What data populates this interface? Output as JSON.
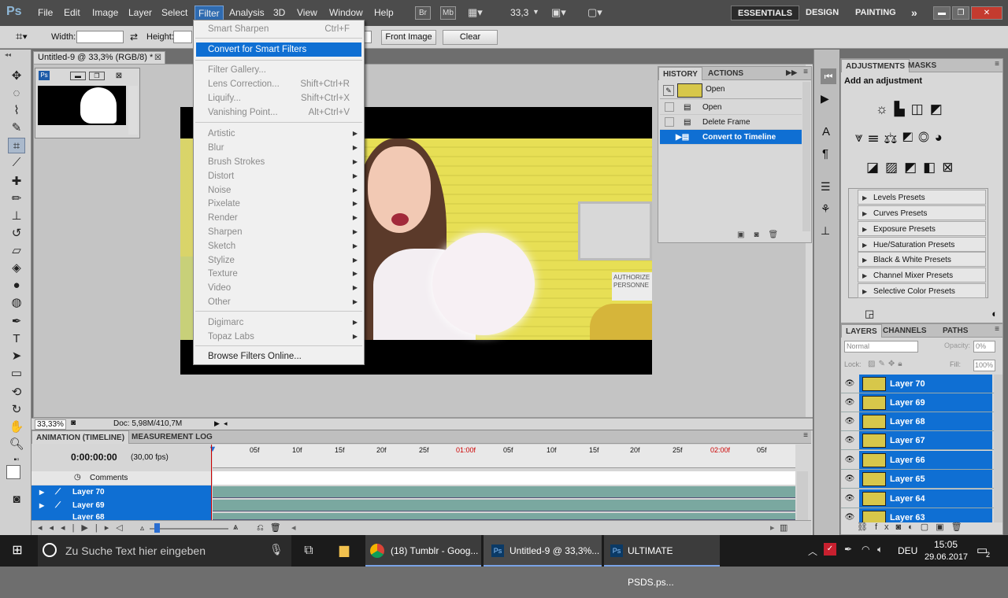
{
  "menubar": {
    "logo": "Ps",
    "items": [
      "File",
      "Edit",
      "Image",
      "Layer",
      "Select",
      "Filter",
      "Analysis",
      "3D",
      "View",
      "Window",
      "Help"
    ],
    "bridge_btn": "Br",
    "mini_btn": "Mb",
    "zoom_value": "33,3",
    "workspaces": [
      "ESSENTIALS",
      "DESIGN",
      "PAINTING"
    ],
    "more": "»"
  },
  "options": {
    "width_label": "Width:",
    "height_label": "Height:",
    "front_image": "Front Image",
    "clear": "Clear"
  },
  "document": {
    "tab_title": "Untitled-9 @ 33,3% (RGB/8) *",
    "zoom": "33,33%",
    "doc_size": "Doc: 5,98M/410,7M",
    "sign_text": "AUTHORIZE\nPERSONNE"
  },
  "filter_menu": {
    "items": [
      {
        "label": "Smart Sharpen",
        "shortcut": "Ctrl+F",
        "enabled": false
      },
      {
        "label": "Convert for Smart Filters",
        "shortcut": "",
        "enabled": true,
        "highlight": true
      },
      {
        "label": "Filter Gallery...",
        "shortcut": "",
        "enabled": false
      },
      {
        "label": "Lens Correction...",
        "shortcut": "Shift+Ctrl+R",
        "enabled": false
      },
      {
        "label": "Liquify...",
        "shortcut": "Shift+Ctrl+X",
        "enabled": false
      },
      {
        "label": "Vanishing Point...",
        "shortcut": "Alt+Ctrl+V",
        "enabled": false
      },
      {
        "label": "Artistic",
        "submenu": true,
        "enabled": false
      },
      {
        "label": "Blur",
        "submenu": true,
        "enabled": false
      },
      {
        "label": "Brush Strokes",
        "submenu": true,
        "enabled": false
      },
      {
        "label": "Distort",
        "submenu": true,
        "enabled": false
      },
      {
        "label": "Noise",
        "submenu": true,
        "enabled": false
      },
      {
        "label": "Pixelate",
        "submenu": true,
        "enabled": false
      },
      {
        "label": "Render",
        "submenu": true,
        "enabled": false
      },
      {
        "label": "Sharpen",
        "submenu": true,
        "enabled": false
      },
      {
        "label": "Sketch",
        "submenu": true,
        "enabled": false
      },
      {
        "label": "Stylize",
        "submenu": true,
        "enabled": false
      },
      {
        "label": "Texture",
        "submenu": true,
        "enabled": false
      },
      {
        "label": "Video",
        "submenu": true,
        "enabled": false
      },
      {
        "label": "Other",
        "submenu": true,
        "enabled": false
      },
      {
        "label": "Digimarc",
        "submenu": true,
        "enabled": false
      },
      {
        "label": "Topaz Labs",
        "submenu": true,
        "enabled": false
      },
      {
        "label": "Browse Filters Online...",
        "shortcut": "",
        "enabled": true
      }
    ]
  },
  "history": {
    "tabs": [
      "HISTORY",
      "ACTIONS"
    ],
    "snapshot": "Open",
    "steps": [
      "Open",
      "Delete Frame",
      "Convert to Timeline"
    ]
  },
  "adjustments": {
    "tabs": [
      "ADJUSTMENTS",
      "MASKS"
    ],
    "heading": "Add an adjustment",
    "presets": [
      "Levels Presets",
      "Curves Presets",
      "Exposure Presets",
      "Hue/Saturation Presets",
      "Black & White Presets",
      "Channel Mixer Presets",
      "Selective Color Presets"
    ]
  },
  "layers": {
    "tabs": [
      "LAYERS",
      "CHANNELS",
      "PATHS"
    ],
    "blend_mode": "Normal",
    "opacity_label": "Opacity:",
    "opacity": "0%",
    "lock_label": "Lock:",
    "fill_label": "Fill:",
    "fill": "100%",
    "items": [
      "Layer 70",
      "Layer 69",
      "Layer 68",
      "Layer 67",
      "Layer 66",
      "Layer 65",
      "Layer 64",
      "Layer 63"
    ]
  },
  "timeline": {
    "tabs": [
      "ANIMATION (TIMELINE)",
      "MEASUREMENT LOG"
    ],
    "time": "0:00:00:00",
    "fps": "(30,00 fps)",
    "comments": "Comments",
    "ruler": [
      "05f",
      "10f",
      "15f",
      "20f",
      "25f",
      "01:00f",
      "05f",
      "10f",
      "15f",
      "20f",
      "25f",
      "02:00f",
      "05f"
    ],
    "rows": [
      "Layer 70",
      "Layer 69",
      "Layer 68"
    ]
  },
  "taskbar": {
    "search_placeholder": "Zu Suche Text hier eingeben",
    "apps": [
      "(18) Tumblr - Goog...",
      "Untitled-9 @ 33,3%...",
      "ULTIMATE PSDS.ps..."
    ],
    "lang": "DEU",
    "time": "15:05",
    "date": "29.06.2017",
    "notif_count": "2"
  },
  "colors": {
    "accent": "#0f6fd3",
    "canvas_yellow": "#e2da55",
    "menubar": "#4c4c4c"
  }
}
